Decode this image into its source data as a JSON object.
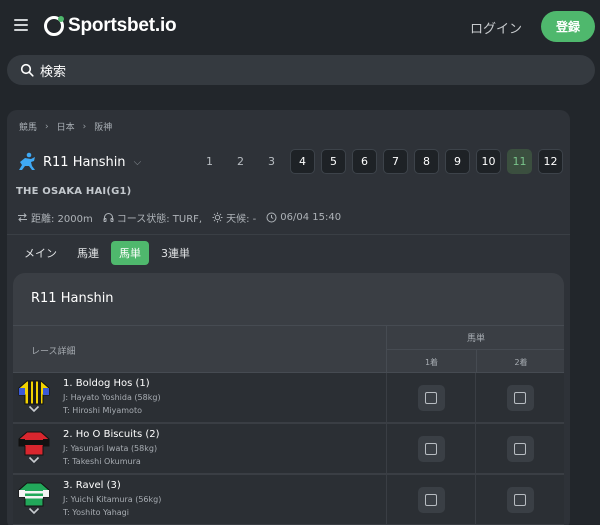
{
  "header": {
    "menu_icon": "hamburger-icon",
    "logo_text": "Sportsbet.io",
    "login_label": "ログイン",
    "register_label": "登録",
    "accent_color": "#4fb86d"
  },
  "search": {
    "placeholder": "検索"
  },
  "breadcrumb": [
    "競馬",
    "日本",
    "阪神"
  ],
  "race": {
    "name": "R11 Hanshin",
    "numbers": [
      "1",
      "2",
      "3",
      "4",
      "5",
      "6",
      "7",
      "8",
      "9",
      "10",
      "11",
      "12"
    ],
    "active_number": "11",
    "title": "THE OSAKA HAI(G1)",
    "distance": "距離: 2000m",
    "course": "コース状態: TURF,",
    "weather": "天候: -",
    "time": "06/04 15:40"
  },
  "tabs": [
    {
      "label": "メイン",
      "active": false
    },
    {
      "label": "馬連",
      "active": false
    },
    {
      "label": "馬単",
      "active": true
    },
    {
      "label": "3連単",
      "active": false
    }
  ],
  "card": {
    "title": "R11 Hanshin",
    "col_details": "レース詳細",
    "col_group": "馬単",
    "col_first": "1着",
    "col_second": "2着"
  },
  "runners": [
    {
      "name": "1. Boldog Hos (1)",
      "jockey": "J: Hayato Yoshida (58kg)",
      "trainer": "T: Hiroshi Miyamoto",
      "silk_colors": [
        "#f2d200",
        "#1a1a1a"
      ]
    },
    {
      "name": "2. Ho O Biscuits (2)",
      "jockey": "J: Yasunari Iwata (58kg)",
      "trainer": "T: Takeshi Okumura",
      "silk_colors": [
        "#d8262e",
        "#111111"
      ]
    },
    {
      "name": "3. Ravel (3)",
      "jockey": "J: Yuichi Kitamura (56kg)",
      "trainer": "T: Yoshito Yahagi",
      "silk_colors": [
        "#22a85a",
        "#f4f4f4"
      ]
    }
  ]
}
